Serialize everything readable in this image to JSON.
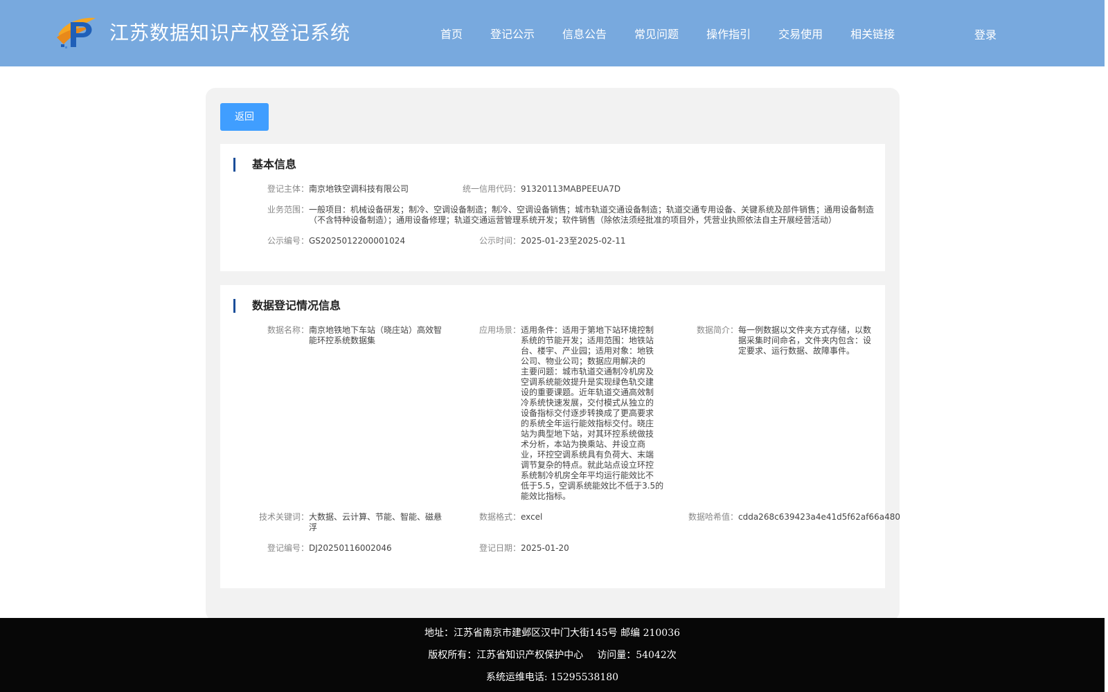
{
  "header": {
    "title": "江苏数据知识产权登记系统",
    "nav": [
      "首页",
      "登记公示",
      "信息公告",
      "常见问题",
      "操作指引",
      "交易使用",
      "相关链接"
    ],
    "login": "登录"
  },
  "back_label": "返回",
  "basic": {
    "title": "基本信息",
    "subject_label": "登记主体：",
    "subject": "南京地铁空调科技有限公司",
    "credit_label": "统一信用代码：",
    "credit": "91320113MABPEEUA7D",
    "scope_label": "业务范围：",
    "scope_line1": "一般项目：机械设备研发；制冷、空调设备制造；制冷、空调设备销售；城市轨道交通设备制造；轨道交通专用设备、关键系统及部件销售；通用设备制造",
    "scope_line2": "（不含特种设备制造）；通用设备修理；轨道交通运营管理系统开发；软件销售（除依法须经批准的项目外，凭营业执照依法自主开展经营活动）",
    "pub_no_label": "公示编号：",
    "pub_no": "GS2025012200001024",
    "pub_time_label": "公示时间：",
    "pub_time": "2025-01-23至2025-02-11"
  },
  "data_reg": {
    "title": "数据登记情况信息",
    "name_label": "数据名称：",
    "name_lines": [
      "南京地铁地下车站（晓庄站）高效智",
      "能环控系统数据集"
    ],
    "scene_label": "应用场景：",
    "scene_lines": [
      "适用条件：适用于第地下站环境控制",
      "系统的节能开发；适用范围：地铁站",
      "台、楼宇、产业园；适用对象：地铁",
      "公司、物业公司；数据应用解决的",
      "主要问题：城市轨道交通制冷机房及",
      "空调系统能效提升是实现绿色轨交建",
      "设的重要课题。近年轨道交通高效制",
      "冷系统快速发展，交付模式从独立的",
      "设备指标交付逐步转换成了更高要求",
      "的系统全年运行能效指标交付。晓庄",
      "站为典型地下站，对其环控系统做技",
      "术分析，本站为换乘站、并设立商",
      "业，环控空调系统具有负荷大、末端",
      "调节复杂的特点。就此站点设立环控",
      "系统制冷机房全年平均运行能效比不",
      "低于5.5，空调系统能效比不低于3.5的",
      "能效比指标。"
    ],
    "intro_label": "数据简介：",
    "intro_lines": [
      "每一例数据以文件夹方式存储，以数",
      "据采集时间命名，文件夹内包含：设",
      "定要求、运行数据、故障事件。"
    ],
    "keywords_label": "技术关键词：",
    "keywords_lines": [
      "大数据、云计算、节能、智能、磁悬",
      "浮"
    ],
    "format_label": "数据格式：",
    "format": "excel",
    "hash_label": "数据哈希值：",
    "hash": "cdda268c639423a4e41d5f62af66a480",
    "reg_no_label": "登记编号：",
    "reg_no": "DJ20250116002046",
    "reg_date_label": "登记日期：",
    "reg_date": "2025-01-20"
  },
  "footer": {
    "address": "地址：江苏省南京市建邺区汉中门大街145号 邮编 210036",
    "copyright": "版权所有：江苏省知识产权保护中心",
    "visits": "访问量：54042次",
    "phone": "系统运维电话: 15295538180"
  },
  "colors": {
    "header_bg": "#78a9de",
    "button_bg": "#409eff",
    "section_bar": "#1a4e99",
    "footer_bg": "#070707"
  }
}
